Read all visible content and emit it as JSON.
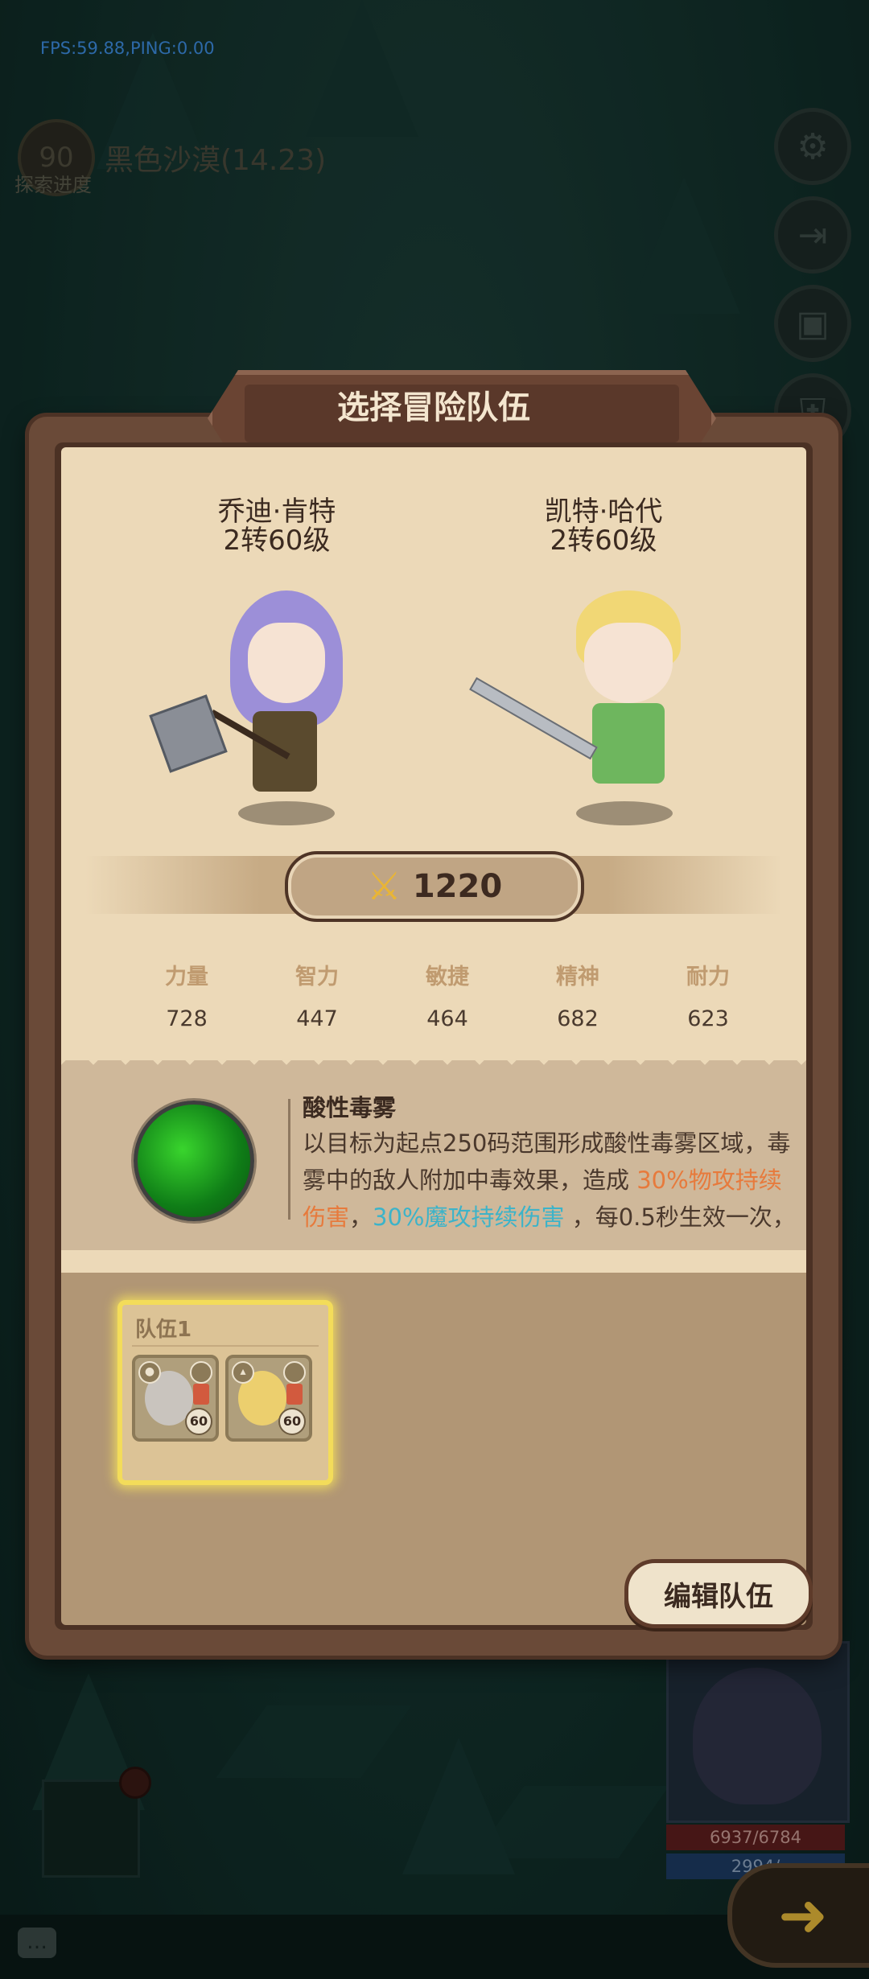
{
  "hud": {
    "fps_text": "FPS:59.88,PING:0.00",
    "region_level": "90",
    "region_name": "黑色沙漠(14.23)",
    "region_sub": "探索进度",
    "hero_hp": "6937/6784",
    "hero_mp": "2994/"
  },
  "dialog": {
    "title": "选择冒险队伍",
    "characters": [
      {
        "name": "乔迪·肯特",
        "level": "2转60级"
      },
      {
        "name": "凯特·哈代",
        "level": "2转60级"
      }
    ],
    "power": "1220",
    "stats": [
      {
        "label": "力量",
        "value": "728"
      },
      {
        "label": "智力",
        "value": "447"
      },
      {
        "label": "敏捷",
        "value": "464"
      },
      {
        "label": "精神",
        "value": "682"
      },
      {
        "label": "耐力",
        "value": "623"
      }
    ],
    "skill": {
      "name": "酸性毒雾",
      "desc_part1": "以目标为起点250码范围形成酸性毒雾区域，毒雾中的敌人附加中毒效果，造成 ",
      "desc_hl1": "30%物攻持续伤害",
      "desc_part2": "，",
      "desc_hl2": "30%魔攻持续伤害",
      "desc_part3": " ，每0.5秒生效一次，"
    },
    "team": {
      "label": "队伍1",
      "members": [
        {
          "level": "60"
        },
        {
          "level": "60"
        }
      ]
    },
    "edit_button": "编辑队伍"
  },
  "colors": {
    "highlight_orange": "#e77a3c",
    "highlight_cyan": "#3cb3c9",
    "team_glow": "#f3dc5a"
  }
}
